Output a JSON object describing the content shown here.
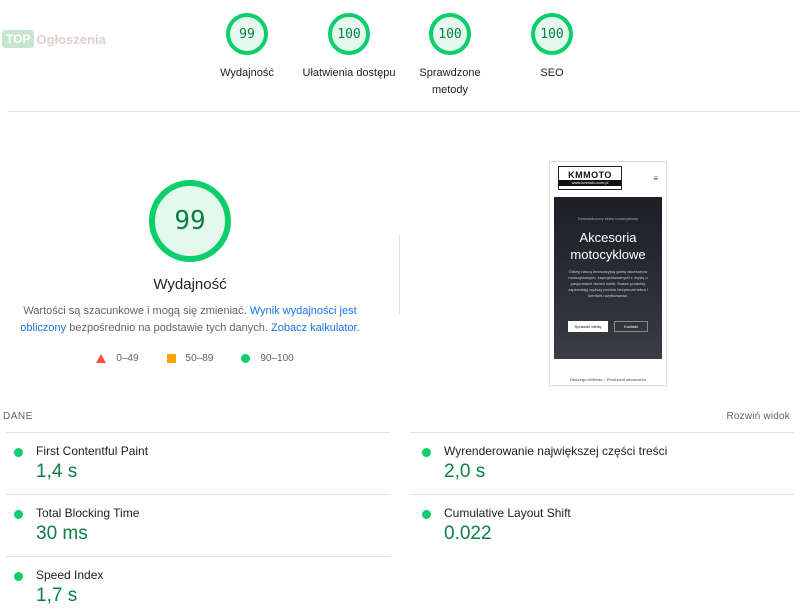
{
  "watermark": {
    "badge": "TOP",
    "text": "Ogłoszenia"
  },
  "gauges": [
    {
      "score": "99",
      "label": "Wydajność"
    },
    {
      "score": "100",
      "label": "Ułatwienia dostępu"
    },
    {
      "score": "100",
      "label": "Sprawdzone metody"
    },
    {
      "score": "100",
      "label": "SEO"
    }
  ],
  "performance": {
    "score": "99",
    "label": "Wydajność",
    "desc_part1": "Wartości są szacunkowe i mogą się zmieniać. ",
    "desc_link1": "Wynik wydajności jest obliczony",
    "desc_part2": " bezpośrednio na podstawie tych danych. ",
    "desc_link2": "Zobacz kalkulator",
    "desc_part3": "."
  },
  "legend": [
    {
      "range": "0–49",
      "color": "#ff4e42"
    },
    {
      "range": "50–89",
      "color": "#ffa400"
    },
    {
      "range": "90–100",
      "color": "#0cce6b"
    }
  ],
  "screenshot": {
    "logo": "KMMOTO",
    "logo_url": "www.kmmoto.com.pl",
    "hero_small": "Doświadczony sklep motocyklowy",
    "hero_title": "Akcesoria motocyklowe",
    "hero_body": "Odkryj naszą innowacyjną gamę akcesoriów motocyklowych, zaprojektowanych z myślą o pasjonatach dwóch kółek. Nasze produkty zapewniają wyższy poziom bezpieczeństwa i komfortu użytkowania.",
    "btn_primary": "Sprawdź ofertę",
    "btn_secondary": "Kontakt",
    "footer": "Dlaczego KMMoto – Producent akcesoriów"
  },
  "metrics": {
    "section_label": "DANE",
    "expand_label": "Rozwiń widok",
    "items": [
      {
        "name": "First Contentful Paint",
        "value": "1,4 s",
        "color": "#0cce6b"
      },
      {
        "name": "Wyrenderowanie największej części treści",
        "value": "2,0 s",
        "color": "#0cce6b"
      },
      {
        "name": "Total Blocking Time",
        "value": "30 ms",
        "color": "#0cce6b"
      },
      {
        "name": "Cumulative Layout Shift",
        "value": "0.022",
        "color": "#0cce6b"
      },
      {
        "name": "Speed Index",
        "value": "1,7 s",
        "color": "#0cce6b"
      }
    ]
  }
}
